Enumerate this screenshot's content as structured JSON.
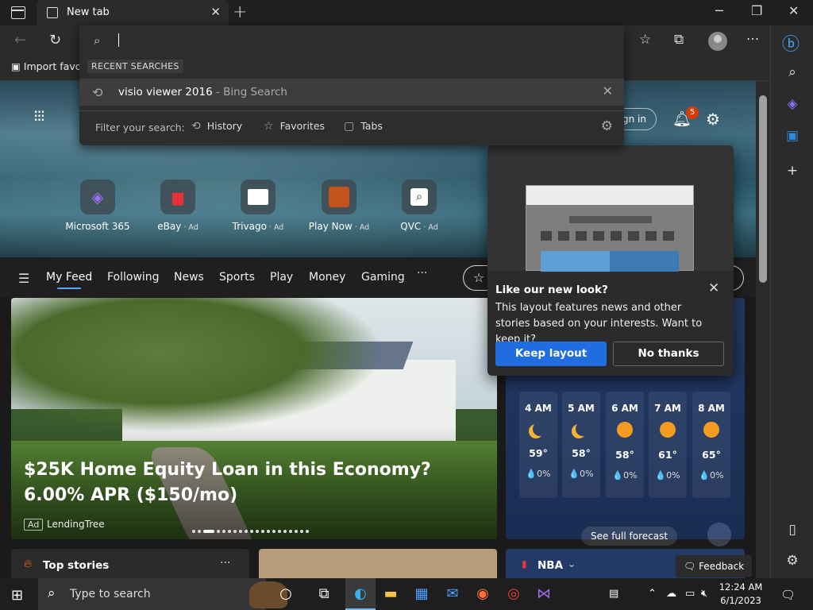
{
  "window": {
    "tab_title": "New tab",
    "new_tab": "+",
    "minimize": "─",
    "restore": "❐",
    "close": "✕"
  },
  "toolbar": {
    "back": "←",
    "refresh": "↻",
    "favorites_icon": "☆",
    "collections_icon": "⧉",
    "more_icon": "···"
  },
  "favorites_bar": {
    "import": "Import favorites"
  },
  "address_dropdown": {
    "recent_label": "RECENT SEARCHES",
    "suggestion_query": "visio viewer 2016",
    "suggestion_source": " - Bing Search",
    "filter_label": "Filter your search:",
    "filters": [
      {
        "icon": "history-icon",
        "label": "History"
      },
      {
        "icon": "star-icon",
        "label": "Favorites"
      },
      {
        "icon": "tabs-icon",
        "label": "Tabs"
      }
    ]
  },
  "newtab": {
    "sign_in": "Sign in",
    "notification_count": "5",
    "quick_links": [
      {
        "label": "Microsoft 365",
        "ad": ""
      },
      {
        "label": "eBay",
        "ad": " · Ad"
      },
      {
        "label": "Trivago",
        "ad": " · Ad"
      },
      {
        "label": "Play Now",
        "ad": " · Ad"
      },
      {
        "label": "QVC",
        "ad": " · Ad"
      }
    ],
    "feed_tabs": [
      "My Feed",
      "Following",
      "News",
      "Sports",
      "Play",
      "Money",
      "Gaming"
    ],
    "feed_more": "···"
  },
  "hero": {
    "title": "$25K Home Equity Loan in this Economy? 6.00% APR ($150/mo)",
    "ad_badge": "Ad",
    "source": "LendingTree"
  },
  "weather": {
    "hours": [
      {
        "time": "4 AM",
        "icon": "moon",
        "temp": "59°",
        "precip": "💧0%"
      },
      {
        "time": "5 AM",
        "icon": "moon",
        "temp": "58°",
        "precip": "💧0%"
      },
      {
        "time": "6 AM",
        "icon": "sun",
        "temp": "58°",
        "precip": "💧0%"
      },
      {
        "time": "7 AM",
        "icon": "sun",
        "temp": "61°",
        "precip": "💧0%"
      },
      {
        "time": "8 AM",
        "icon": "sun",
        "temp": "65°",
        "precip": "💧0%"
      }
    ],
    "see_forecast": "See full forecast"
  },
  "popup": {
    "title": "Like our new look?",
    "body": "This layout features news and other stories based on your interests. Want to keep it?",
    "keep": "Keep layout",
    "no": "No thanks"
  },
  "bottom": {
    "top_stories": "Top stories",
    "more": "···",
    "nba": "NBA",
    "feedback": "Feedback"
  },
  "taskbar": {
    "search_placeholder": "Type to search",
    "time": "12:24 AM",
    "date": "6/1/2023"
  },
  "colors": {
    "accent": "#1f6de0",
    "badge": "#d83b01",
    "taskbar": "#1e1e1e"
  }
}
